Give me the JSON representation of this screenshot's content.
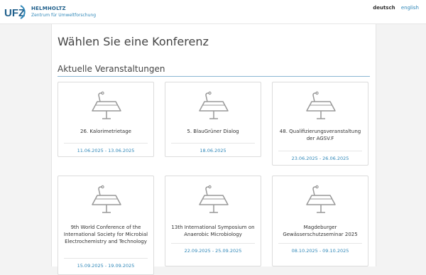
{
  "header": {
    "logo_line1": "HELMHOLTZ",
    "logo_line2": "Zentrum für Umweltforschung",
    "logo_mark": "UFZ",
    "lang_de": "deutsch",
    "lang_en": "english"
  },
  "page": {
    "title": "Wählen Sie eine Konferenz",
    "section": "Aktuelle Veranstaltungen"
  },
  "conferences": [
    {
      "title": "26. Kalorimetrietage",
      "start": "11.06.2025",
      "end": "13.06.2025",
      "icon": "podium-icon"
    },
    {
      "title": "5. BlauGrüner Dialog",
      "start": "18.06.2025",
      "end": "",
      "icon": "podium-icon"
    },
    {
      "title": "48. Qualifizierungsveranstaltung der AGSV.F",
      "start": "23.06.2025",
      "end": "26.06.2025",
      "icon": "podium-icon"
    },
    {
      "title": "9th World Conference of the International Society for Microbial Electrochemistry and Technology",
      "start": "15.09.2025",
      "end": "19.09.2025",
      "icon": "podium-icon"
    },
    {
      "title": "13th International Symposium on Anaerobic Microbiology",
      "start": "22.09.2025",
      "end": "25.09.2025",
      "icon": "podium-icon"
    },
    {
      "title": "Magdeburger Gewässerschutzseminar 2025",
      "start": "08.10.2025",
      "end": "09.10.2025",
      "icon": "podium-icon"
    }
  ],
  "colors": {
    "accent": "#2f87b8",
    "brand": "#1f5f8b",
    "icon": "#999999"
  }
}
